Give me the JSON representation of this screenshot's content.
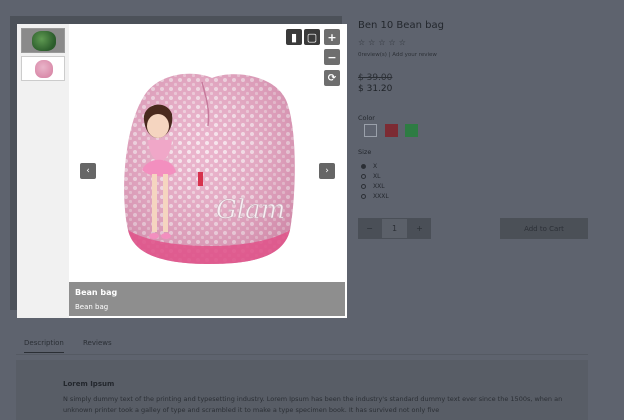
{
  "product": {
    "title": "Ben 10 Bean bag",
    "stars": "☆☆☆☆☆",
    "review_links": "0review(s)  |  Add your review",
    "old_price": "$ 39.00",
    "new_price": "$ 31.20",
    "color_label": "Color",
    "colors": [
      "#5f6470",
      "#7c2b33",
      "#2e7c43"
    ],
    "size_label": "Size",
    "sizes": [
      {
        "label": "X",
        "selected": true
      },
      {
        "label": "XL",
        "selected": false
      },
      {
        "label": "XXL",
        "selected": false
      },
      {
        "label": "XXXL",
        "selected": false
      }
    ],
    "qty_minus": "−",
    "qty_value": "1",
    "qty_plus": "+",
    "add_to_cart": "Add to Cart"
  },
  "tabs": [
    "Description",
    "Reviews"
  ],
  "description": {
    "heading": "Lorem Ipsum",
    "text": "N simply dummy text of the printing and typesetting industry. Lorem Ipsum has been the industry's standard dummy text ever since the 1500s, when an unknown printer took a galley of type and scrambled it to make a type specimen book. It has survived not only five"
  },
  "lightbox": {
    "caption_title": "Bean bag",
    "caption_sub": "Bean bag",
    "controls": {
      "autoplay_icon": "play-pause-icon",
      "fullscreen_icon": "fullscreen-icon",
      "zoom_in": "+",
      "zoom_out": "−",
      "rotate_icon": "rotate-icon",
      "prev": "‹",
      "next": "›",
      "thumb_toggle_icon": "swap-icon"
    },
    "bag_text": "Glam"
  }
}
